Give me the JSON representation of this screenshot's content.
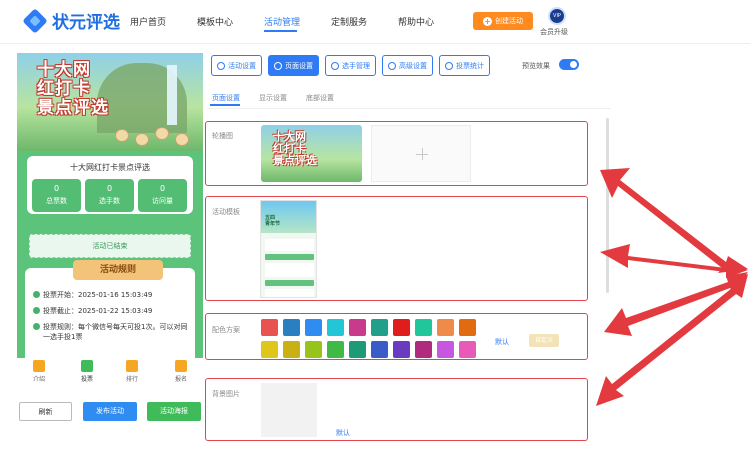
{
  "header": {
    "logo_text": "状元评选",
    "nav": [
      "用户首页",
      "模板中心",
      "活动管理",
      "定制服务",
      "帮助中心"
    ],
    "active_nav": "活动管理",
    "create_label": "创建活动",
    "vip_badge": "VIP",
    "vip_label": "会员升级"
  },
  "preview": {
    "banner_title_lines": [
      "十大网",
      "红打卡",
      "景点评选"
    ],
    "card_title": "十大网红打卡景点评选",
    "stats": [
      {
        "value": "0",
        "label": "总票数"
      },
      {
        "value": "0",
        "label": "选手数"
      },
      {
        "value": "0",
        "label": "访问量"
      }
    ],
    "status": "活动已结束",
    "rules_title": "活动规则",
    "rules": [
      "投票开始：2025-01-16 15:03:49",
      "投票截止：2025-01-22 15:03:49",
      "投票规则：每个微信号每天可投1次。可以对同一选手投1票"
    ],
    "tabs": [
      "介绍",
      "投票",
      "排行",
      "报名"
    ],
    "active_tab": "投票",
    "buttons": {
      "refresh": "刷新",
      "publish": "发布活动",
      "poster": "活动海报"
    }
  },
  "toolbar": {
    "buttons": [
      "活动设置",
      "页面设置",
      "选手管理",
      "高级设置",
      "投票统计"
    ],
    "active": "页面设置",
    "preview_toggle_label": "预览效果",
    "preview_toggle_on": true
  },
  "subtabs": {
    "items": [
      "页面设置",
      "显示设置",
      "底部设置"
    ],
    "active": "页面设置"
  },
  "sections": {
    "carousel_label": "轮播图",
    "carousel_thumb_title_lines": [
      "十大网",
      "红打卡",
      "景点评选"
    ],
    "template_label": "活动模板",
    "template_thumb_lines": [
      "五四",
      "青年节"
    ],
    "colors_label": "配色方案",
    "color_row1": [
      "#e8534f",
      "#2a7fc0",
      "#2f8cf0",
      "#22c6d6",
      "#c83a8c",
      "#20a089",
      "#e01c1c",
      "#21c79a",
      "#f08a4b",
      "#e06b10"
    ],
    "color_row2": [
      "#e0c61a",
      "#c9b014",
      "#96c41a",
      "#3fba47",
      "#1f9a78",
      "#3a5cc8",
      "#6a3bc0",
      "#b02a7e",
      "#c756e0",
      "#e85ab8"
    ],
    "default_link": "默认",
    "custom_button": "自定义",
    "bg_label": "背景图片",
    "bg_default_link": "默认"
  },
  "accent": "#2f7bf5",
  "highlight_color": "#e2464d"
}
